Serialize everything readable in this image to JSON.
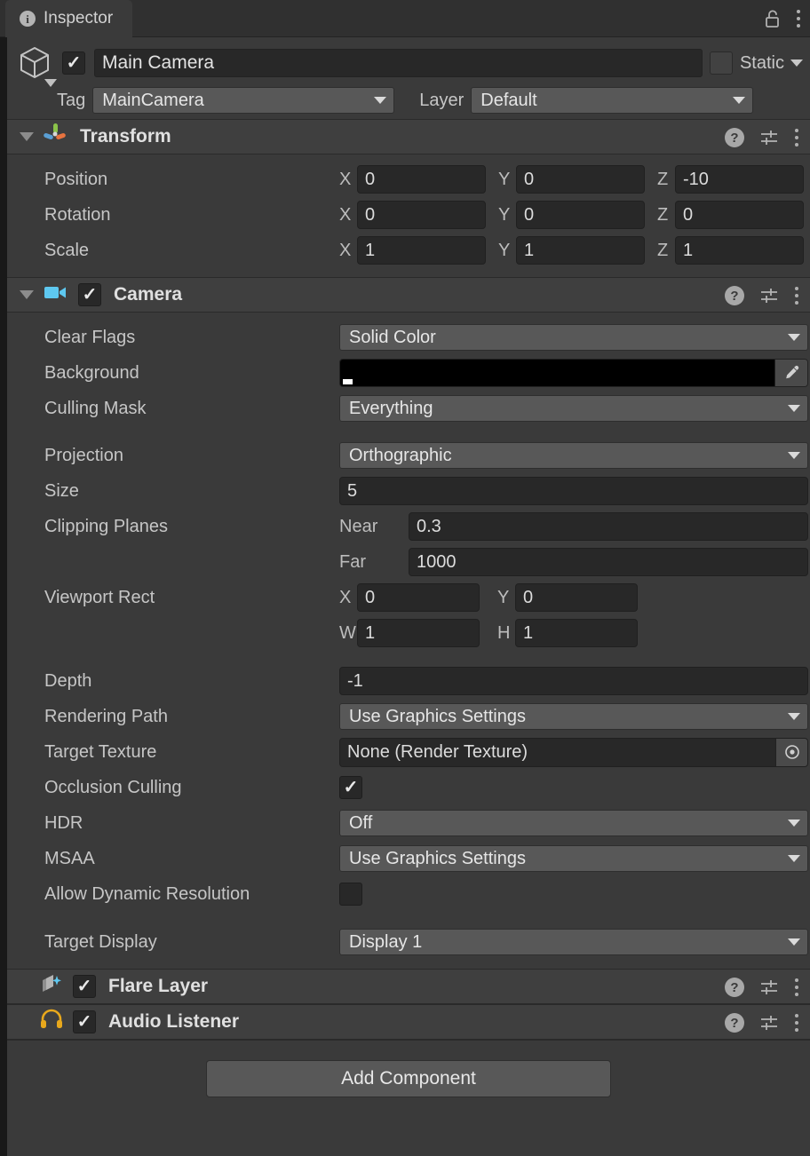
{
  "window": {
    "tab_label": "Inspector",
    "tab_icon": "info-icon",
    "lock_icon": "lock-open-icon",
    "menu_icon": "kebab-menu-icon"
  },
  "gameobject": {
    "icon": "cube-icon",
    "enabled": true,
    "name": "Main Camera",
    "static_checked": false,
    "static_label": "Static",
    "tag_label": "Tag",
    "tag_value": "MainCamera",
    "layer_label": "Layer",
    "layer_value": "Default"
  },
  "components": [
    {
      "id": "transform",
      "title": "Transform",
      "icon": "transform-axes-icon",
      "has_checkbox": false,
      "expanded": true,
      "rows": [
        {
          "label": "Position",
          "type": "vector3",
          "axes": [
            "X",
            "Y",
            "Z"
          ],
          "values": [
            "0",
            "0",
            "-10"
          ]
        },
        {
          "label": "Rotation",
          "type": "vector3",
          "axes": [
            "X",
            "Y",
            "Z"
          ],
          "values": [
            "0",
            "0",
            "0"
          ]
        },
        {
          "label": "Scale",
          "type": "vector3",
          "axes": [
            "X",
            "Y",
            "Z"
          ],
          "values": [
            "1",
            "1",
            "1"
          ]
        }
      ]
    },
    {
      "id": "camera",
      "title": "Camera",
      "icon": "video-camera-icon",
      "has_checkbox": true,
      "enabled": true,
      "expanded": true,
      "rows": [
        {
          "label": "Clear Flags",
          "type": "dropdown",
          "value": "Solid Color"
        },
        {
          "label": "Background",
          "type": "color",
          "value": "#000000"
        },
        {
          "label": "Culling Mask",
          "type": "dropdown",
          "value": "Everything"
        },
        {
          "label": "Projection",
          "type": "dropdown",
          "value": "Orthographic"
        },
        {
          "label": "Size",
          "type": "number",
          "value": "5"
        },
        {
          "label": "Clipping Planes",
          "type": "pair",
          "sub_label_1": "Near",
          "value_1": "0.3",
          "sub_label_2": "Far",
          "value_2": "1000"
        },
        {
          "label": "Viewport Rect",
          "type": "rect",
          "axes": [
            "X",
            "Y",
            "W",
            "H"
          ],
          "values": [
            "0",
            "0",
            "1",
            "1"
          ]
        },
        {
          "label": "Depth",
          "type": "number",
          "value": "-1"
        },
        {
          "label": "Rendering Path",
          "type": "dropdown",
          "value": "Use Graphics Settings"
        },
        {
          "label": "Target Texture",
          "type": "object",
          "value": "None (Render Texture)"
        },
        {
          "label": "Occlusion Culling",
          "type": "checkbox",
          "checked": true
        },
        {
          "label": "HDR",
          "type": "dropdown",
          "value": "Off"
        },
        {
          "label": "MSAA",
          "type": "dropdown",
          "value": "Use Graphics Settings"
        },
        {
          "label": "Allow Dynamic Resolution",
          "type": "checkbox",
          "checked": false
        },
        {
          "label": "Target Display",
          "type": "dropdown",
          "value": "Display 1"
        }
      ]
    },
    {
      "id": "flare-layer",
      "title": "Flare Layer",
      "icon": "flare-layer-icon",
      "has_checkbox": true,
      "enabled": true,
      "expanded": false,
      "rows": []
    },
    {
      "id": "audio-listener",
      "title": "Audio Listener",
      "icon": "headphones-icon",
      "has_checkbox": true,
      "enabled": true,
      "expanded": false,
      "rows": []
    }
  ],
  "footer": {
    "add_component_label": "Add Component"
  },
  "colors": {
    "panel_bg": "#3a3a3a",
    "header_bg": "#3f3f3f",
    "field_bg": "#282828",
    "dropdown_bg": "#585858",
    "text": "#c6c6c6",
    "camera_icon": "#5ec8f0",
    "audio_icon": "#e8a81c",
    "axis_x": "#5a9fd4",
    "axis_y": "#8bc34a",
    "axis_z": "#e8733f"
  }
}
